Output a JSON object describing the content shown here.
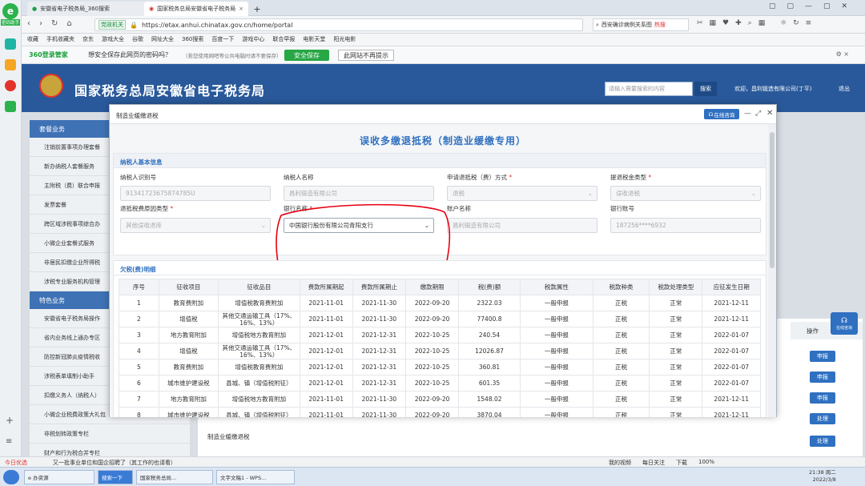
{
  "browser": {
    "tabs": [
      {
        "label": "安徽省电子税务局_360搜索"
      },
      {
        "label": "国家税务总局安徽省电子税务局"
      }
    ],
    "new_tab": "+",
    "site_badge": "党政机关",
    "url": "https://etax.anhui.chinatax.gov.cn/home/portal",
    "search_placeholder": "西安确诊病例关系图",
    "hot_label": "热搜",
    "favorites": [
      "收藏",
      "手机收藏夹",
      "京东",
      "游戏大全",
      "谷歌",
      "网址大全",
      "360搜索",
      "百度一下",
      "游戏中心",
      "联合早报",
      "电影天堂",
      "阳光电影"
    ],
    "pw_brand": "360登录管家",
    "pw_question": "想安全保存此网页的密码吗？",
    "pw_note": "（若您使用网吧等公共电脑时请不要保存）",
    "pw_save": "安全保存",
    "pw_never": "此网站不再提示",
    "side_badge": "密码助手"
  },
  "site": {
    "title": "国家税务总局安徽省电子税务局",
    "search_placeholder": "请输入需要搜索的内容",
    "search_button": "搜索",
    "welcome": "欢迎，昌利锻造有限公司(丁平)",
    "logout": "退出",
    "menu_head1": "套餐业务",
    "menu_items1": [
      "注销前置事项办理套餐",
      "新办纳税人套餐服务",
      "主附税（费）联合申报",
      "发票套餐",
      "跨区域涉税事项综合办",
      "小微企业套餐式服务",
      "非居民扣缴企业所得税",
      "涉税专业服务机构管理"
    ],
    "menu_head2": "特色业务",
    "menu_items2": [
      "安徽省电子税务局操作",
      "省内业务线上通办专区",
      "防控新冠肺炎疫情税收",
      "涉税表单填制小助手",
      "扣缴义务人（纳税人）",
      "小微企业税费政策大礼包",
      "非税划转政策专栏",
      "财产和行为税合并专栏"
    ],
    "bg_op_header": "操作",
    "bg_buttons": [
      "申报",
      "申报",
      "申报",
      "处理",
      "处理"
    ],
    "bg_row_text": "制造业缓缴退税",
    "side_float": "在线咨询"
  },
  "modal": {
    "window_title": "制造业缓缴退税",
    "online_button": "在线咨询",
    "heading": "误收多缴退抵税（制造业缓缴专用）",
    "section1": "纳税人基本信息",
    "fields": [
      {
        "label": "纳税人识别号",
        "value": "91341723675874785U",
        "required": false
      },
      {
        "label": "纳税人名称",
        "value": "昌利锻造有限公司",
        "required": false
      },
      {
        "label": "申请退抵税（费）方式",
        "value": "退税",
        "required": true
      },
      {
        "label": "提退税金类型",
        "value": "误收退税",
        "required": true
      },
      {
        "label": "退抵税费原因类型",
        "value": "其他误收退库",
        "required": true
      },
      {
        "label": "银行名称",
        "value": "中国银行股份有限公司青阳支行",
        "required": true
      },
      {
        "label": "账户名称",
        "value": "昌利锻造有限公司",
        "required": false
      },
      {
        "label": "银行账号",
        "value": "187256****6932",
        "required": false
      }
    ],
    "section2": "欠税(费)明细",
    "columns": [
      "序号",
      "征收项目",
      "征收品目",
      "费款所属期起",
      "费款所属期止",
      "缴款期限",
      "税(费)额",
      "税款属性",
      "税款种类",
      "税款处理类型",
      "应征发生日期"
    ],
    "rows": [
      [
        "1",
        "教育费附加",
        "增值税教育费附加",
        "2021-11-01",
        "2021-11-30",
        "2022-09-20",
        "2322.03",
        "一般申报",
        "正税",
        "正常",
        "2021-12-11"
      ],
      [
        "2",
        "增值税",
        "其他交通运输工具（17%、16%、13%）",
        "2021-11-01",
        "2021-11-30",
        "2022-09-20",
        "77400.8",
        "一般申报",
        "正税",
        "正常",
        "2021-12-11"
      ],
      [
        "3",
        "地方教育附加",
        "增值税地方教育附加",
        "2021-12-01",
        "2021-12-31",
        "2022-10-25",
        "240.54",
        "一般申报",
        "正税",
        "正常",
        "2022-01-07"
      ],
      [
        "4",
        "增值税",
        "其他交通运输工具（17%、16%、13%）",
        "2021-12-01",
        "2021-12-31",
        "2022-10-25",
        "12026.87",
        "一般申报",
        "正税",
        "正常",
        "2022-01-07"
      ],
      [
        "5",
        "教育费附加",
        "增值税教育费附加",
        "2021-12-01",
        "2021-12-31",
        "2022-10-25",
        "360.81",
        "一般申报",
        "正税",
        "正常",
        "2022-01-07"
      ],
      [
        "6",
        "城市维护建设税",
        "县城、镇（增值税附征）",
        "2021-12-01",
        "2021-12-31",
        "2022-10-25",
        "601.35",
        "一般申报",
        "正税",
        "正常",
        "2022-01-07"
      ],
      [
        "7",
        "地方教育附加",
        "增值税地方教育附加",
        "2021-11-01",
        "2021-11-30",
        "2022-09-20",
        "1548.02",
        "一般申报",
        "正税",
        "正常",
        "2021-12-11"
      ],
      [
        "8",
        "城市维护建设税",
        "县城、镇（增值税附征）",
        "2021-11-01",
        "2021-11-30",
        "2022-09-20",
        "3870.04",
        "一般申报",
        "正税",
        "正常",
        "2021-12-11"
      ]
    ]
  },
  "statusbar": {
    "left1": "今日优选",
    "left2": "又一批事业单位和国企招聘了（其工作的也请看）",
    "right": [
      "我的视频",
      "每日关注",
      "下载",
      "100%"
    ]
  },
  "taskbar": {
    "items": [
      "e 办资源",
      "搜索一下",
      "国家税务总局...",
      "文字文稿1 - WPS..."
    ],
    "time": "21:38 周二",
    "date": "2022/3/8"
  },
  "colors": {
    "brand_blue": "#29599a",
    "accent_blue": "#2f70c0",
    "required_red": "#e2322b",
    "annotation_red": "#e60012"
  }
}
